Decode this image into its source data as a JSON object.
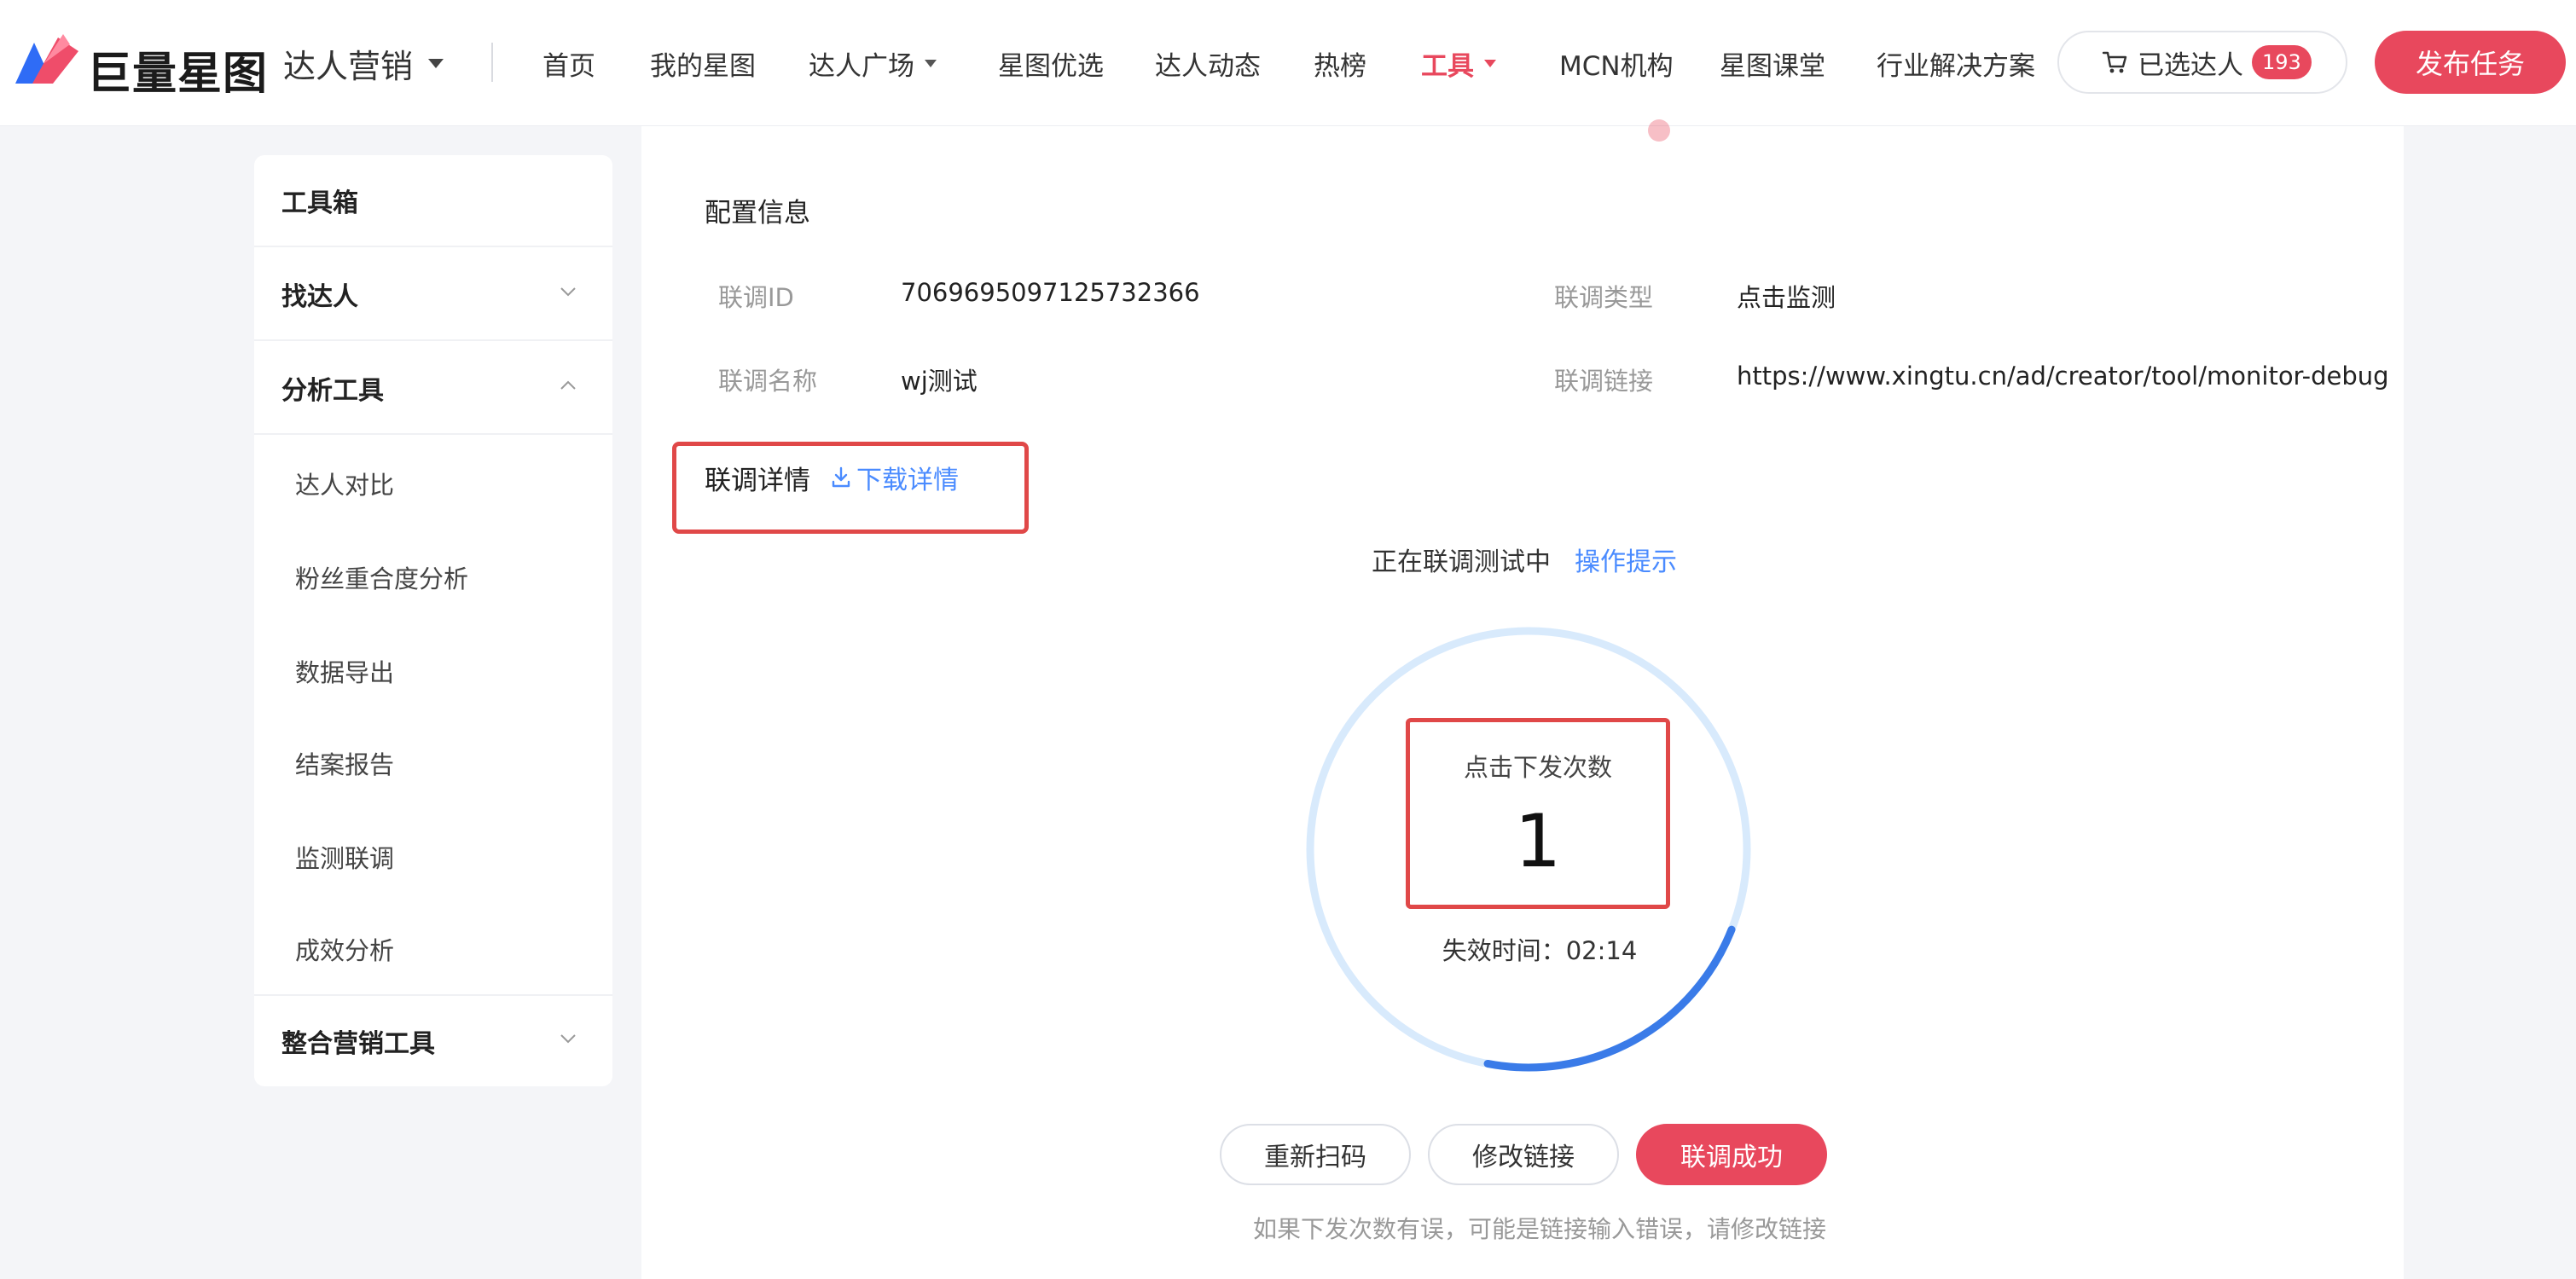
{
  "colors": {
    "accent": "#e8485d",
    "link": "#4a8bff",
    "highlight_border": "#e04848",
    "ring_track": "#d8eafc",
    "ring_progress": "#3a7be8",
    "page_bg": "#f4f5f8"
  },
  "header": {
    "logo_text": "巨量星图",
    "brand_menu": "达人营销",
    "nav": [
      {
        "label": "首页"
      },
      {
        "label": "我的星图"
      },
      {
        "label": "达人广场"
      },
      {
        "label": "星图优选"
      },
      {
        "label": "达人动态"
      },
      {
        "label": "热榜"
      },
      {
        "label": "工具"
      },
      {
        "label": "MCN机构"
      },
      {
        "label": "星图课堂"
      },
      {
        "label": "行业解决方案"
      }
    ],
    "cart_label": "已选达人",
    "cart_count": "193",
    "publish_label": "发布任务"
  },
  "sidebar": {
    "toolbox": "工具箱",
    "find": "找达人",
    "analysis": "分析工具",
    "items": [
      {
        "label": "达人对比"
      },
      {
        "label": "粉丝重合度分析"
      },
      {
        "label": "数据导出"
      },
      {
        "label": "结案报告"
      },
      {
        "label": "监测联调"
      },
      {
        "label": "成效分析"
      }
    ],
    "integrated": "整合营销工具"
  },
  "main": {
    "section_title": "配置信息",
    "info": {
      "id_label": "联调ID",
      "id_value": "7069695097125732366",
      "type_label": "联调类型",
      "type_value": "点击监测",
      "name_label": "联调名称",
      "name_value": "wj测试",
      "link_label": "联调链接",
      "link_value": "https://www.xingtu.cn/ad/creator/tool/monitor-debug"
    },
    "detail_title": "联调详情",
    "download_label": "下载详情",
    "status_text": "正在联调测试中",
    "tip_label": "操作提示",
    "count_label": "点击下发次数",
    "count_value": "1",
    "expire_text": "失效时间：02:14",
    "countdown_remaining_fraction": 0.22,
    "buttons": {
      "rescan": "重新扫码",
      "modify": "修改链接",
      "success": "联调成功"
    },
    "hint": "如果下发次数有误，可能是链接输入错误，请修改链接"
  }
}
